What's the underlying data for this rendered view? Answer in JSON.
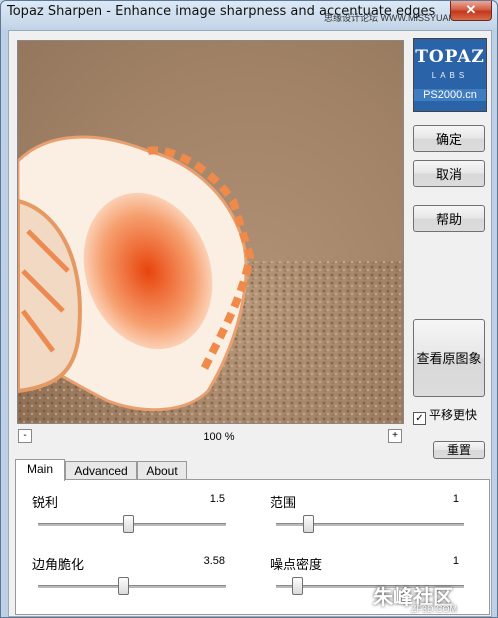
{
  "window": {
    "title": "Topaz Sharpen - Enhance image sharpness and accentuate edges",
    "watermark_top": "思缘设计论坛 WWW.MISSYUAN.COM",
    "close_label": "✕"
  },
  "logo": {
    "brand": "TOPAZ",
    "sub": "LABS",
    "site": "PS2000.cn"
  },
  "buttons": {
    "ok": "确定",
    "cancel": "取消",
    "help": "帮助",
    "view_original": "查看原图象",
    "reset": "重置"
  },
  "pan_checkbox": {
    "label": "平移更快",
    "checked": true
  },
  "zoom": {
    "minus": "-",
    "plus": "+",
    "level": "100 %"
  },
  "tabs": [
    "Main",
    "Advanced",
    "About"
  ],
  "active_tab": "Main",
  "params": {
    "sharpness": {
      "label": "锐利",
      "value": "1.5",
      "fraction": 0.48
    },
    "range": {
      "label": "范围",
      "value": "1",
      "fraction": 0.17
    },
    "edge_crispness": {
      "label": "边角脆化",
      "value": "3.58",
      "fraction": 0.45
    },
    "noise_density": {
      "label": "噪点密度",
      "value": "1",
      "fraction": 0.11
    }
  },
  "watermark_bottom": {
    "main": "朱峰社区",
    "sub": "ZF3D.COM"
  }
}
